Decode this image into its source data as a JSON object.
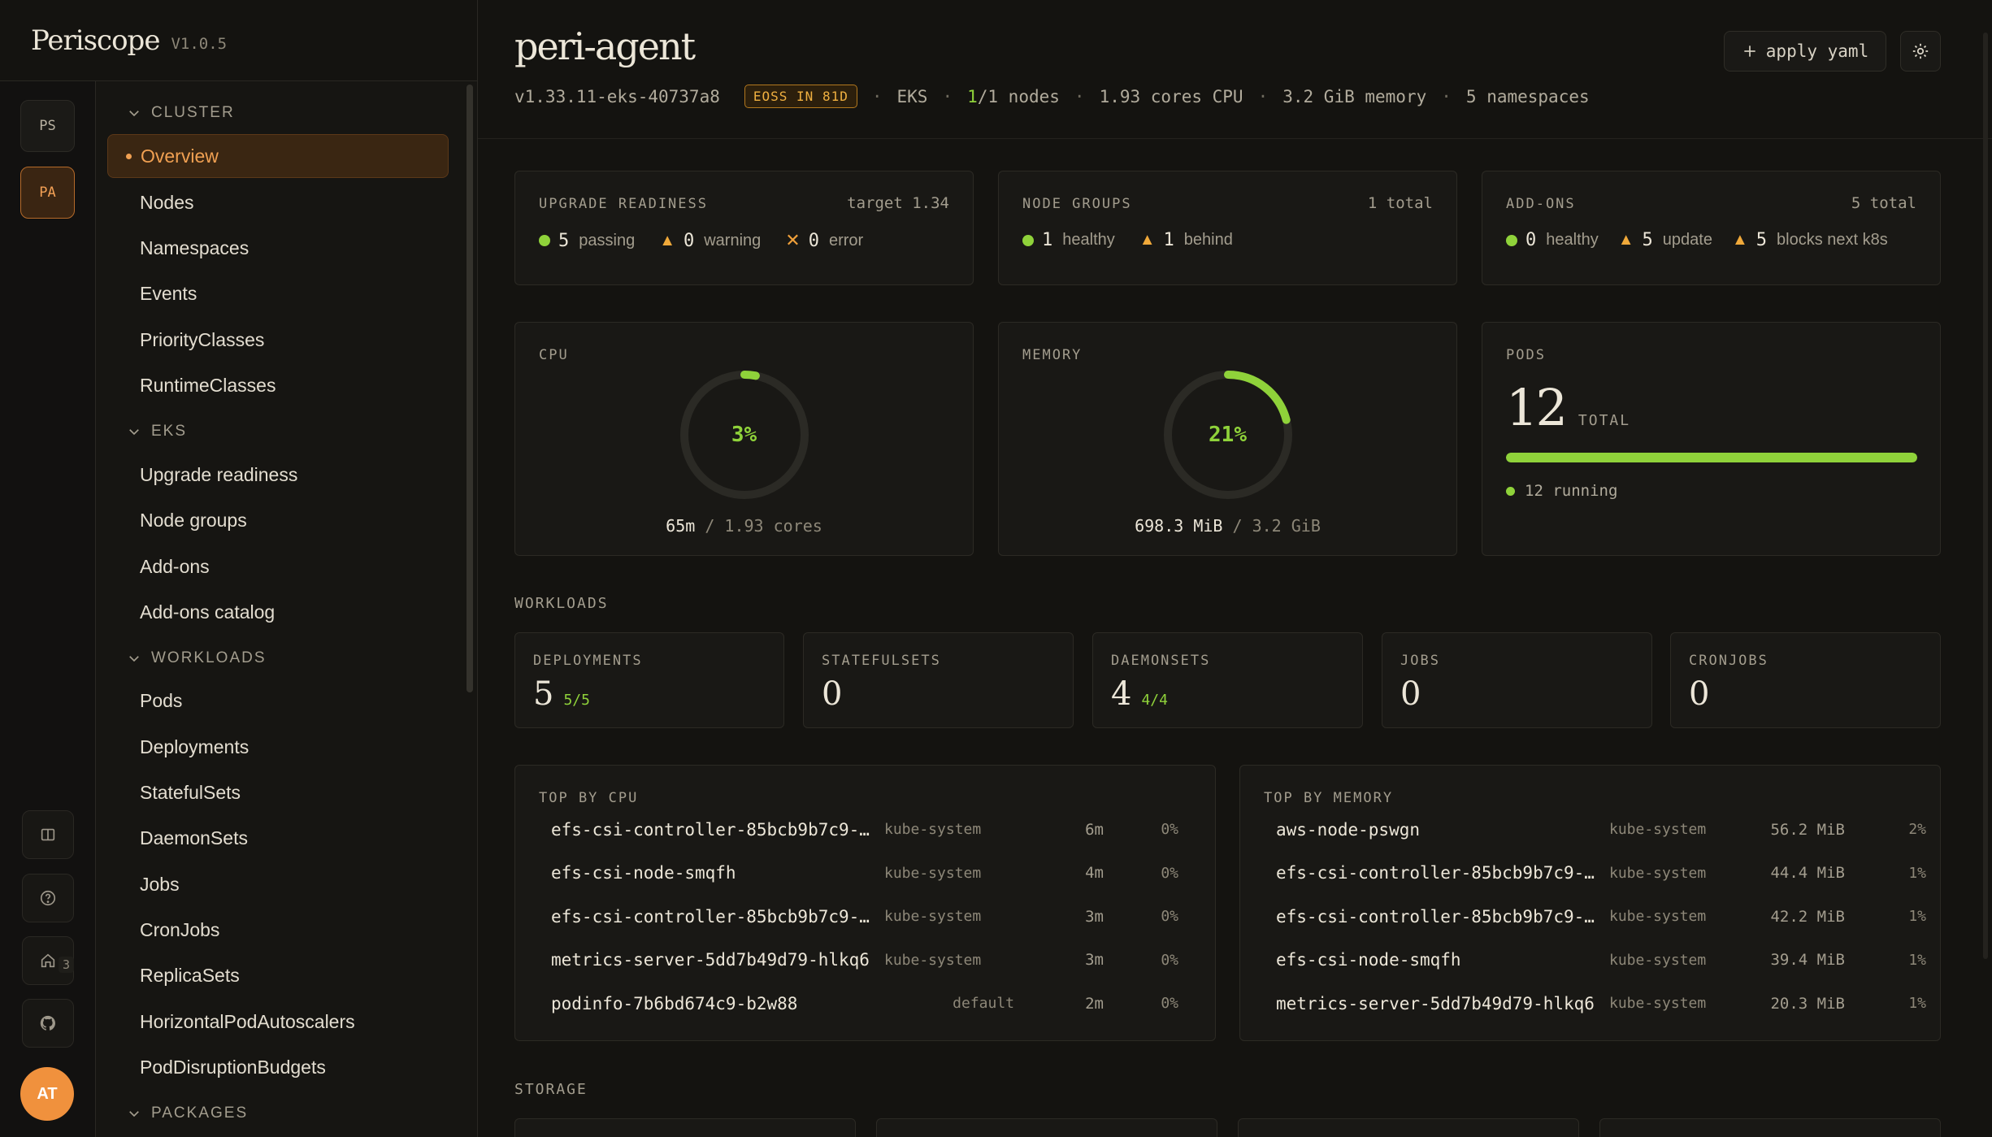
{
  "app": {
    "name": "Periscope",
    "version": "V1.0.5"
  },
  "rail": {
    "clusters": [
      {
        "initials": "PS",
        "active": false
      },
      {
        "initials": "PA",
        "active": true
      }
    ],
    "github_count": "3",
    "avatar": "AT"
  },
  "sidebar": {
    "sections": [
      {
        "title": "CLUSTER",
        "items": [
          "Overview",
          "Nodes",
          "Namespaces",
          "Events",
          "PriorityClasses",
          "RuntimeClasses"
        ]
      },
      {
        "title": "EKS",
        "items": [
          "Upgrade readiness",
          "Node groups",
          "Add-ons",
          "Add-ons catalog"
        ]
      },
      {
        "title": "WORKLOADS",
        "items": [
          "Pods",
          "Deployments",
          "StatefulSets",
          "DaemonSets",
          "Jobs",
          "CronJobs",
          "ReplicaSets",
          "HorizontalPodAutoscalers",
          "PodDisruptionBudgets"
        ]
      },
      {
        "title": "PACKAGES",
        "items": []
      }
    ],
    "active": "Overview"
  },
  "header": {
    "title": "peri-agent",
    "version": "v1.33.11-eks-40737a8",
    "eoss": "EOSS IN 81D",
    "provider": "EKS",
    "nodes_ready": "1",
    "nodes_total": "/1 nodes",
    "cpu": "1.93 cores CPU",
    "memory": "3.2 GiB memory",
    "namespaces": "5 namespaces",
    "apply_label": "apply yaml"
  },
  "upgrade": {
    "label": "UPGRADE READINESS",
    "target": "target 1.34",
    "passing": "5",
    "passing_label": "passing",
    "warning": "0",
    "warning_label": "warning",
    "error": "0",
    "error_label": "error"
  },
  "node_groups": {
    "label": "NODE GROUPS",
    "total": "1 total",
    "healthy": "1",
    "healthy_label": "healthy",
    "behind": "1",
    "behind_label": "behind"
  },
  "addons": {
    "label": "ADD-ONS",
    "total": "5 total",
    "healthy": "0",
    "healthy_label": "healthy",
    "update": "5",
    "update_label": "update",
    "blocks": "5",
    "blocks_label": "blocks next k8s"
  },
  "cpu": {
    "label": "CPU",
    "percent": 3,
    "percent_text": "3%",
    "used": "65m",
    "total": "/ 1.93 cores"
  },
  "memory": {
    "label": "MEMORY",
    "percent": 21,
    "percent_text": "21%",
    "used": "698.3 MiB",
    "total": "/ 3.2 GiB"
  },
  "pods": {
    "label": "PODS",
    "count": "12",
    "total_label": "TOTAL",
    "running_fraction": 1.0,
    "running": "12 running"
  },
  "workloads": {
    "title": "WORKLOADS",
    "cards": [
      {
        "label": "DEPLOYMENTS",
        "value": "5",
        "ratio": "5/5"
      },
      {
        "label": "STATEFULSETS",
        "value": "0",
        "ratio": ""
      },
      {
        "label": "DAEMONSETS",
        "value": "4",
        "ratio": "4/4"
      },
      {
        "label": "JOBS",
        "value": "0",
        "ratio": ""
      },
      {
        "label": "CRONJOBS",
        "value": "0",
        "ratio": ""
      }
    ]
  },
  "top_cpu": {
    "title": "TOP BY CPU",
    "rows": [
      {
        "name": "efs-csi-controller-85bcb9b7c9-…",
        "ns": "kube-system",
        "value": "6m",
        "pct": "0%"
      },
      {
        "name": "efs-csi-node-smqfh",
        "ns": "kube-system",
        "value": "4m",
        "pct": "0%"
      },
      {
        "name": "efs-csi-controller-85bcb9b7c9-…",
        "ns": "kube-system",
        "value": "3m",
        "pct": "0%"
      },
      {
        "name": "metrics-server-5dd7b49d79-hlkq6",
        "ns": "kube-system",
        "value": "3m",
        "pct": "0%"
      },
      {
        "name": "podinfo-7b6bd674c9-b2w88",
        "ns": "default",
        "value": "2m",
        "pct": "0%"
      }
    ]
  },
  "top_memory": {
    "title": "TOP BY MEMORY",
    "rows": [
      {
        "name": "aws-node-pswgn",
        "ns": "kube-system",
        "value": "56.2 MiB",
        "pct": "2%"
      },
      {
        "name": "efs-csi-controller-85bcb9b7c9-…",
        "ns": "kube-system",
        "value": "44.4 MiB",
        "pct": "1%"
      },
      {
        "name": "efs-csi-controller-85bcb9b7c9-…",
        "ns": "kube-system",
        "value": "42.2 MiB",
        "pct": "1%"
      },
      {
        "name": "efs-csi-node-smqfh",
        "ns": "kube-system",
        "value": "39.4 MiB",
        "pct": "1%"
      },
      {
        "name": "metrics-server-5dd7b49d79-hlkq6",
        "ns": "kube-system",
        "value": "20.3 MiB",
        "pct": "1%"
      }
    ]
  },
  "storage": {
    "title": "STORAGE"
  },
  "colors": {
    "accent": "#f0a052",
    "healthy": "#8fd23a",
    "warning": "#f0a93a"
  }
}
